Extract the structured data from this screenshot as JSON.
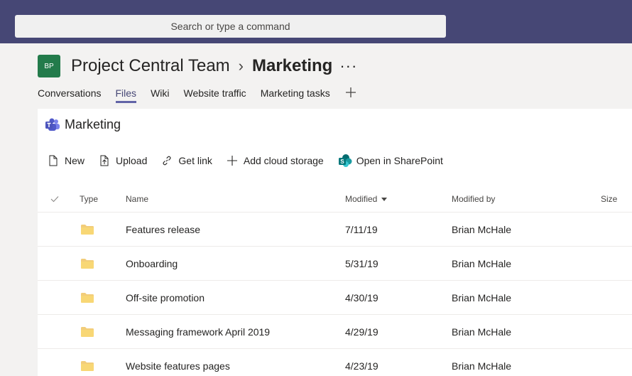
{
  "search": {
    "placeholder": "Search or type a command"
  },
  "team": {
    "avatar_initials": "BP",
    "name": "Project Central Team",
    "channel": "Marketing",
    "more": "···"
  },
  "tabs": [
    {
      "label": "Conversations"
    },
    {
      "label": "Files"
    },
    {
      "label": "Wiki"
    },
    {
      "label": "Website traffic"
    },
    {
      "label": "Marketing tasks"
    }
  ],
  "add_tab_icon": "plus-icon",
  "library": {
    "title": "Marketing"
  },
  "toolbar": {
    "new": "New",
    "upload": "Upload",
    "get_link": "Get link",
    "add_cloud": "Add cloud storage",
    "open_sharepoint": "Open in SharePoint"
  },
  "columns": {
    "type": "Type",
    "name": "Name",
    "modified": "Modified",
    "modified_by": "Modified by",
    "size": "Size"
  },
  "files": [
    {
      "name": "Features release",
      "modified": "7/11/19",
      "modified_by": "Brian McHale"
    },
    {
      "name": "Onboarding",
      "modified": "5/31/19",
      "modified_by": "Brian McHale"
    },
    {
      "name": "Off-site promotion",
      "modified": "4/30/19",
      "modified_by": "Brian McHale"
    },
    {
      "name": "Messaging framework April 2019",
      "modified": "4/29/19",
      "modified_by": "Brian McHale"
    },
    {
      "name": "Website features pages",
      "modified": "4/23/19",
      "modified_by": "Brian McHale"
    }
  ],
  "colors": {
    "topbar": "#464775",
    "accent": "#6264a7",
    "avatar": "#237b4b",
    "folder": "#f2cd7a"
  }
}
